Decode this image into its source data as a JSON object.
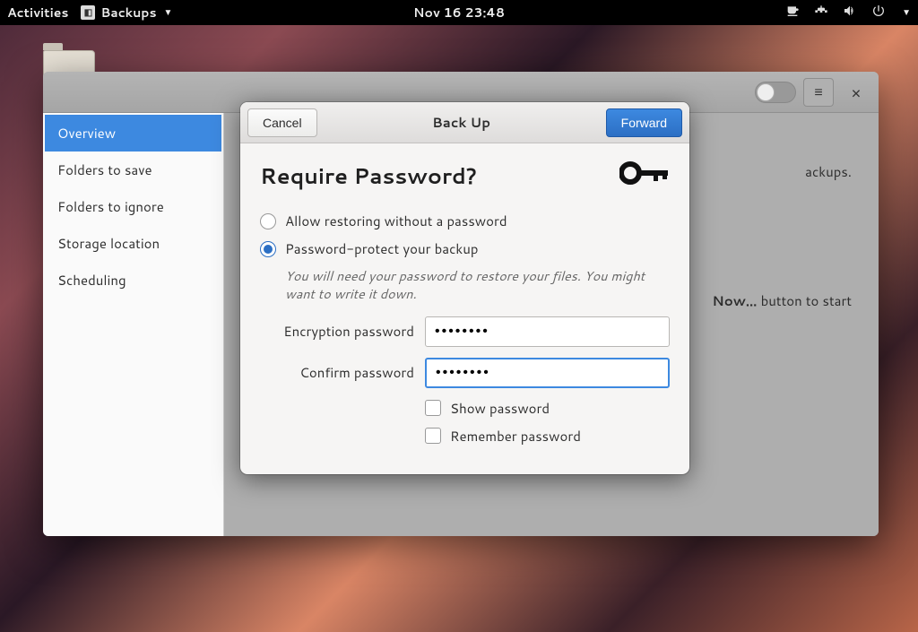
{
  "topbar": {
    "activities": "Activities",
    "app_name": "Backups",
    "datetime": "Nov 16  23:48"
  },
  "app_window": {
    "menu_glyph": "≡",
    "close_glyph": "×"
  },
  "sidebar": {
    "items": [
      {
        "label": "Overview",
        "selected": true
      },
      {
        "label": "Folders to save",
        "selected": false
      },
      {
        "label": "Folders to ignore",
        "selected": false
      },
      {
        "label": "Storage location",
        "selected": false
      },
      {
        "label": "Scheduling",
        "selected": false
      }
    ]
  },
  "background_hints": {
    "line1_suffix": "ackups.",
    "line2_bold": "Now…",
    "line2_rest": " button to start"
  },
  "dialog": {
    "cancel": "Cancel",
    "title": "Back Up",
    "forward": "Forward",
    "heading": "Require Password?",
    "radio_allow": "Allow restoring without a password",
    "radio_protect": "Password-protect your backup",
    "help": "You will need your password to restore your files. You might want to write it down.",
    "enc_label": "Encryption password",
    "conf_label": "Confirm password",
    "enc_value": "••••••••",
    "conf_value": "••••••••",
    "show_password": "Show password",
    "remember_password": "Remember password",
    "selected_option": "protect"
  }
}
